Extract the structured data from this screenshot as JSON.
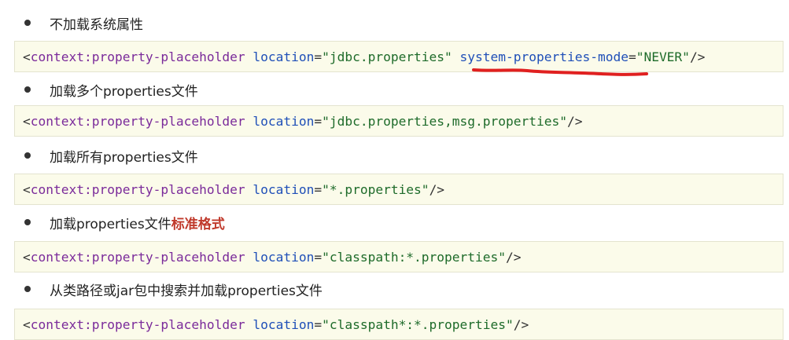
{
  "colors": {
    "code_background": "#fbfbea",
    "tag": "#7a2a9a",
    "attribute": "#1f4fb8",
    "string": "#1e6b2a",
    "highlight": "#c0392b",
    "underline": "#e02020"
  },
  "sections": [
    {
      "bullet": "不加载系统属性",
      "code": {
        "open": "<",
        "tag": "context:property-placeholder",
        "attr1": "location",
        "eq1": "=",
        "val1": "\"jdbc.properties\"",
        "attr2": "system-properties-mode",
        "eq2": "=",
        "val2": "\"NEVER\"",
        "close": "/>"
      }
    },
    {
      "bullet": "加载多个properties文件",
      "code": {
        "open": "<",
        "tag": "context:property-placeholder",
        "attr1": "location",
        "eq1": "=",
        "val1": "\"jdbc.properties,msg.properties\"",
        "close": "/>"
      }
    },
    {
      "bullet": "加载所有properties文件",
      "code": {
        "open": "<",
        "tag": "context:property-placeholder",
        "attr1": "location",
        "eq1": "=",
        "val1": "\"*.properties\"",
        "close": "/>"
      }
    },
    {
      "bullet": "加载properties文件",
      "bullet_highlight": "标准格式",
      "code": {
        "open": "<",
        "tag": "context:property-placeholder",
        "attr1": "location",
        "eq1": "=",
        "val1": "\"classpath:*.properties\"",
        "close": "/>"
      }
    },
    {
      "bullet": "从类路径或jar包中搜索并加载properties文件",
      "code": {
        "open": "<",
        "tag": "context:property-placeholder",
        "attr1": "location",
        "eq1": "=",
        "val1": "\"classpath*:*.properties\"",
        "close": "/>"
      }
    }
  ]
}
